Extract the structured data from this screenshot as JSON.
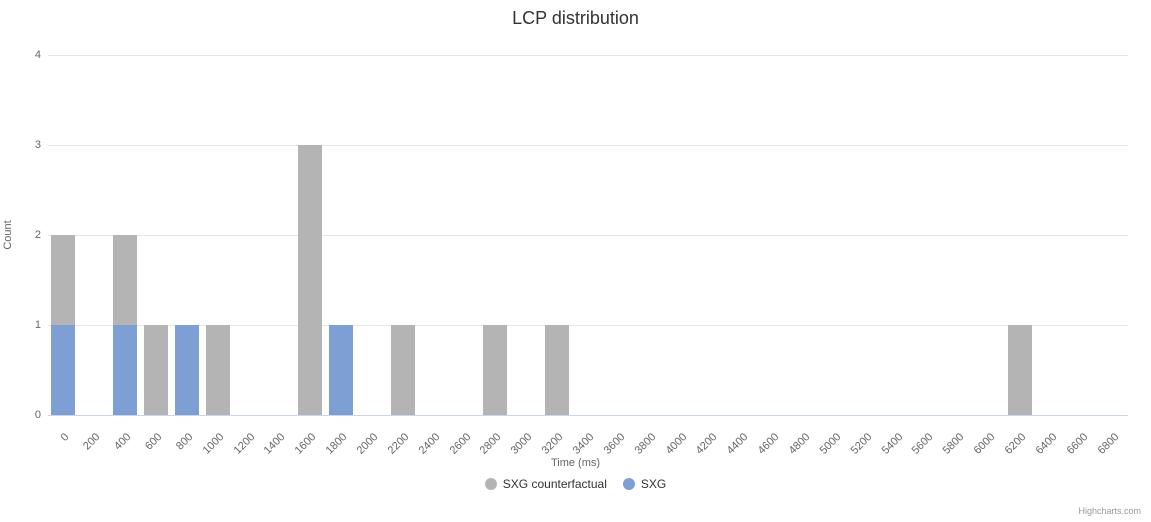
{
  "chart_data": {
    "type": "bar",
    "title": "LCP distribution",
    "xlabel": "Time (ms)",
    "ylabel": "Count",
    "ylim": [
      0,
      4
    ],
    "y_ticks": [
      0,
      1,
      2,
      3,
      4
    ],
    "categories": [
      0,
      200,
      400,
      600,
      800,
      1000,
      1200,
      1400,
      1600,
      1800,
      2000,
      2200,
      2400,
      2600,
      2800,
      3000,
      3200,
      3400,
      3600,
      3800,
      4000,
      4200,
      4400,
      4600,
      4800,
      5000,
      5200,
      5400,
      5600,
      5800,
      6000,
      6200,
      6400,
      6600,
      6800
    ],
    "series": [
      {
        "name": "SXG counterfactual",
        "color": "#b4b4b4",
        "values": [
          2,
          0,
          2,
          1,
          1,
          1,
          0,
          0,
          3,
          0,
          0,
          1,
          0,
          0,
          1,
          0,
          1,
          0,
          0,
          0,
          0,
          0,
          0,
          0,
          0,
          0,
          0,
          0,
          0,
          0,
          0,
          1,
          0,
          0,
          0
        ]
      },
      {
        "name": "SXG",
        "color": "#7e9fd3",
        "values": [
          1,
          0,
          1,
          0,
          1,
          0,
          0,
          0,
          0,
          1,
          0,
          0,
          0,
          0,
          0,
          0,
          0,
          0,
          0,
          0,
          0,
          0,
          0,
          0,
          0,
          0,
          0,
          0,
          0,
          0,
          0,
          0,
          0,
          0,
          0
        ]
      }
    ],
    "legend_position": "bottom",
    "grid": true
  },
  "credits": "Highcharts.com"
}
